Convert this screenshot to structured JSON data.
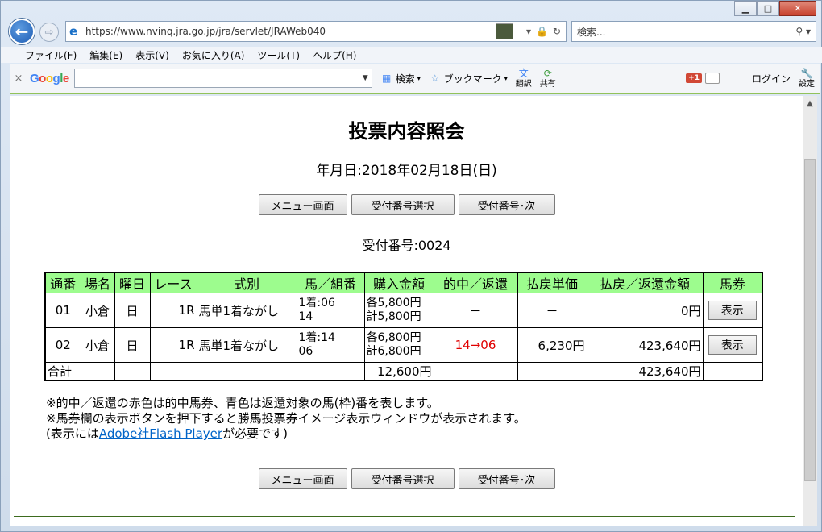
{
  "browser": {
    "url": "https://www.nvinq.jra.go.jp/jra/servlet/JRAWeb040",
    "search_placeholder": "検索...",
    "menu": [
      "ファイル(F)",
      "編集(E)",
      "表示(V)",
      "お気に入り(A)",
      "ツール(T)",
      "ヘルプ(H)"
    ]
  },
  "google_toolbar": {
    "close": "×",
    "search_label": "検索",
    "bookmark_label": "ブックマーク",
    "translate_label": "翻訳",
    "share_label": "共有",
    "gplus_label": "+1",
    "login_label": "ログイン",
    "settings_label": "設定"
  },
  "page": {
    "title": "投票内容照会",
    "date_line": "年月日:2018年02月18日(日)",
    "buttons": {
      "menu": "メニュー画面",
      "select": "受付番号選択",
      "next": "受付番号･次"
    },
    "receipt": "受付番号:0024",
    "table": {
      "headers": [
        "通番",
        "場名",
        "曜日",
        "レース",
        "式別",
        "馬／組番",
        "購入金額",
        "的中／返還",
        "払戻単価",
        "払戻／返還金額",
        "馬券"
      ],
      "rows": [
        {
          "no": "01",
          "venue": "小倉",
          "day": "日",
          "race": "1R",
          "type": "馬単1着ながし",
          "combo1": "1着:06",
          "combo2": "14",
          "amount1": "各5,800円",
          "amount2": "計5,800円",
          "hit": "－",
          "unit": "－",
          "payout": "0円",
          "ticket": "表示"
        },
        {
          "no": "02",
          "venue": "小倉",
          "day": "日",
          "race": "1R",
          "type": "馬単1着ながし",
          "combo1": "1着:14",
          "combo2": "06",
          "amount1": "各6,800円",
          "amount2": "計6,800円",
          "hit": "14→06",
          "unit": "6,230円",
          "payout": "423,640円",
          "ticket": "表示"
        }
      ],
      "total": {
        "label": "合計",
        "amount": "12,600円",
        "payout": "423,640円"
      }
    },
    "notes": {
      "line1": "※的中／返還の赤色は的中馬券、青色は返還対象の馬(枠)番を表します。",
      "line2": "※馬券欄の表示ボタンを押下すると勝馬投票券イメージ表示ウィンドウが表示されます。",
      "line3_prefix": "(表示には",
      "line3_link": "Adobe社Flash Player",
      "line3_suffix": "が必要です)"
    }
  },
  "colors": {
    "header_bg": "#9dfc8e",
    "hit_red": "#e00000",
    "link_blue": "#0064c8",
    "toolbar_green": "#92c25a"
  }
}
